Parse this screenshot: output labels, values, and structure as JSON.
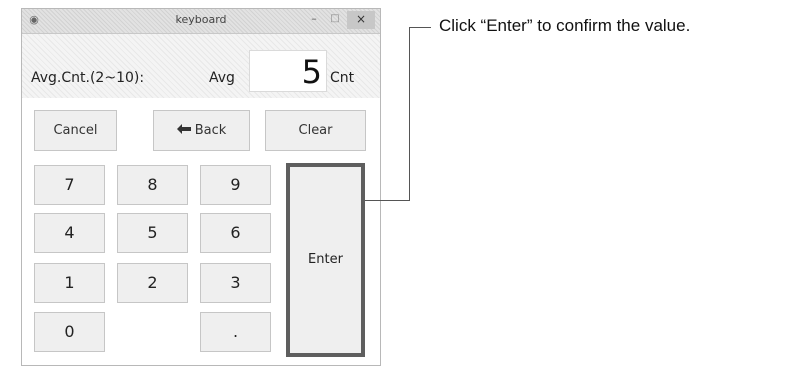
{
  "window": {
    "title": "keyboard",
    "app_icon": "app-icon",
    "minimize_glyph": "–",
    "maximize_glyph": "□",
    "close_glyph": "×"
  },
  "input": {
    "range_label": "Avg.Cnt.(2~10):",
    "prefix": "Avg",
    "value": "5",
    "unit": "Cnt"
  },
  "actions": {
    "cancel": "Cancel",
    "back": "Back",
    "back_icon": "left-arrow-icon",
    "clear": "Clear"
  },
  "keypad": {
    "keys": [
      "7",
      "8",
      "9",
      "4",
      "5",
      "6",
      "1",
      "2",
      "3",
      "0",
      "."
    ],
    "enter": "Enter"
  },
  "callout": "Click “Enter” to confirm the value."
}
